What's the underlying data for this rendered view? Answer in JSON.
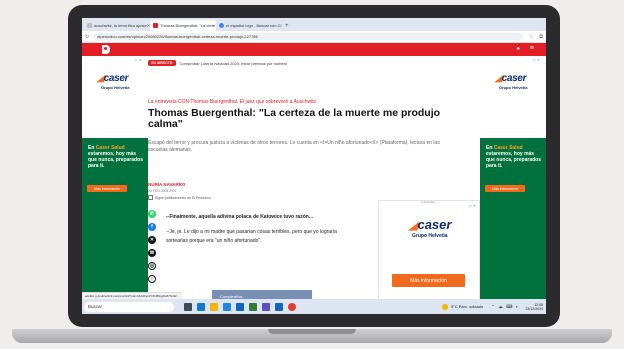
{
  "browser": {
    "tabs": [
      {
        "label": "auschwitz, la terrorífica ajuste",
        "active": false,
        "color": "#e8eaed"
      },
      {
        "label": "Thomas Buergenthal: \"La certe",
        "active": true,
        "color": "#e31e24"
      },
      {
        "label": "el español logo - Buscar con G",
        "active": false,
        "color": "#4285f4"
      }
    ],
    "new_tab": "+",
    "url": "elperiodico.com/es/opinion/20080226/thomas-buergenthal-certeza-muerte-produjo-227786"
  },
  "site": {
    "brand_color": "#e31e24",
    "header_user_icon": "user-icon",
    "header_menu_icon": "hamburger-menu-icon"
  },
  "breaking": {
    "pill": "EN DIRECTO",
    "text": "Comprobar Lotería Navidad 2024: mirar premios por número"
  },
  "article": {
    "kicker": "La entrevista CON Thomas Buergenthal, El juez que sobrevivió a Auschwitz",
    "headline": "Thomas Buergenthal: \"La certeza de la muerte me produjo calma\"",
    "subtitle": "Escapó del terror y procura justicia a víctimas de otros terrores. Lo cuenta en <I>Un niño afortunado</I> (Plataforma), lectura en las escuelas alemanas.",
    "author": "NÚRIA NAVARRO",
    "date": "26 FEB 2008 3:00",
    "follow": "Sigue publicaciones de El Periódico",
    "paragraphs": [
      "--Finalmente, aquella adivina polaca de Katowice tuvo razón...",
      "--Je, je. Le dijo a mi madre que pasarían cosas terribles, pero que yo lograría sortearlas porque era \"un niño afortunado\"."
    ]
  },
  "ads": {
    "chip": "▷ ✕",
    "brand_main": "caser",
    "brand_sub": "Grupo Helvetia",
    "rail_text_prefix": "En",
    "rail_text_highlight": "Caser Salud",
    "rail_text_rest": "estaremos, hoy más que nunca, preparados para ti.",
    "rail_cta": "Más información",
    "inline_label": "Publicidad",
    "inline_cta": "Más información",
    "accent_color": "#f06b1e",
    "green_color": "#00703c",
    "navy_color": "#0c2c73"
  },
  "status_url": "adclick.g.doubleclick.net/pcs/click?xai=AKAOjsv3YdbI8Sqj2H87NnW...",
  "bottom_banner_text": "Cumpleaños",
  "taskbar": {
    "search_placeholder": "Buscar",
    "weather": "5°C  Parc. soleado",
    "time": "12:08",
    "date": "23/12/2024"
  }
}
